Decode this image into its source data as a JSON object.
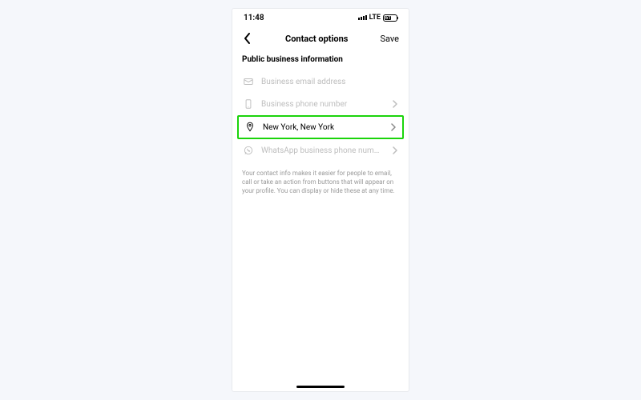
{
  "status_bar": {
    "time": "11:48",
    "network_label": "LTE",
    "battery_text": "61"
  },
  "header": {
    "title": "Contact options",
    "save_label": "Save"
  },
  "section_title": "Public business information",
  "rows": [
    {
      "icon": "mail-icon",
      "label": "Business email address",
      "filled": false,
      "has_chevron": false,
      "highlight": false
    },
    {
      "icon": "phone-icon",
      "label": "Business phone number",
      "filled": false,
      "has_chevron": true,
      "highlight": false
    },
    {
      "icon": "location-icon",
      "label": "New York, New York",
      "filled": true,
      "has_chevron": true,
      "highlight": true
    },
    {
      "icon": "whatsapp-icon",
      "label": "WhatsApp business phone num…",
      "filled": false,
      "has_chevron": true,
      "highlight": false
    }
  ],
  "info_text": "Your contact info makes it easier for people to email, call or take an action from buttons that will appear on your profile. You can display or hide these at any time."
}
